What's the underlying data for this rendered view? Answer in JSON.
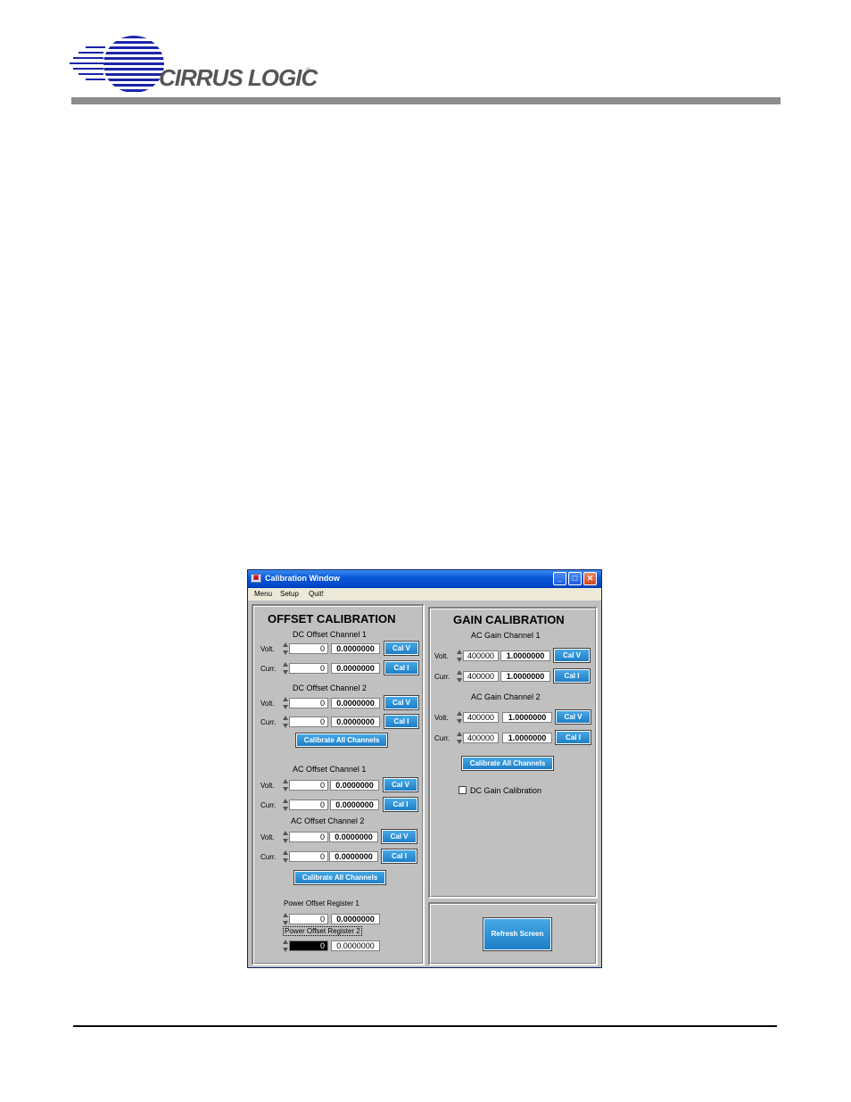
{
  "header": {
    "logo_text": "CIRRUS LOGIC",
    "logo_mark": "®"
  },
  "window": {
    "title": "Calibration Window",
    "menu": [
      "Menu",
      "Setup",
      "Quit!"
    ]
  },
  "offset": {
    "title": "OFFSET CALIBRATION",
    "dc1": {
      "title": "DC Offset Channel 1",
      "volt": {
        "label": "Volt.",
        "value": "0",
        "display": "0.0000000",
        "button": "Cal V"
      },
      "curr": {
        "label": "Curr.",
        "value": "0",
        "display": "0.0000000",
        "button": "Cal I"
      }
    },
    "dc2": {
      "title": "DC Offset Channel 2",
      "volt": {
        "label": "Volt.",
        "value": "0",
        "display": "0.0000000",
        "button": "Cal V"
      },
      "curr": {
        "label": "Curr.",
        "value": "0",
        "display": "0.0000000",
        "button": "Cal I"
      }
    },
    "dc_all": "Calibrate All Channels",
    "ac1": {
      "title": "AC Offset Channel 1",
      "volt": {
        "label": "Volt.",
        "value": "0",
        "display": "0.0000000",
        "button": "Cal V"
      },
      "curr": {
        "label": "Curr.",
        "value": "0",
        "display": "0.0000000",
        "button": "Cal I"
      }
    },
    "ac2": {
      "title": "AC Offset Channel 2",
      "volt": {
        "label": "Volt.",
        "value": "0",
        "display": "0.0000000",
        "button": "Cal V"
      },
      "curr": {
        "label": "Curr.",
        "value": "0",
        "display": "0.0000000",
        "button": "Cal I"
      }
    },
    "ac_all": "Calibrate All Channels",
    "pow1": {
      "title": "Power Offset Register 1",
      "value": "0",
      "display": "0.0000000"
    },
    "pow2": {
      "title": "Power Offset Register 2",
      "value": "0",
      "display": "0.0000000"
    }
  },
  "gain": {
    "title": "GAIN CALIBRATION",
    "ac1": {
      "title": "AC Gain Channel 1",
      "volt": {
        "label": "Volt.",
        "value": "400000",
        "display": "1.0000000",
        "button": "Cal V"
      },
      "curr": {
        "label": "Curr.",
        "value": "400000",
        "display": "1.0000000",
        "button": "Cal I"
      }
    },
    "ac2": {
      "title": "AC Gain Channel 2",
      "volt": {
        "label": "Volt.",
        "value": "400000",
        "display": "1.0000000",
        "button": "Cal V"
      },
      "curr": {
        "label": "Curr.",
        "value": "400000",
        "display": "1.0000000",
        "button": "Cal I"
      }
    },
    "all": "Calibrate All Channels",
    "dc_gain_label": "DC Gain Calibration",
    "dc_gain_checked": false
  },
  "refresh": "Refresh Screen",
  "colors": {
    "button": "#1e7fc7",
    "titlebar": "#0a5ad8",
    "panel": "#c0c0c0",
    "rule": "#8c8c8c"
  }
}
